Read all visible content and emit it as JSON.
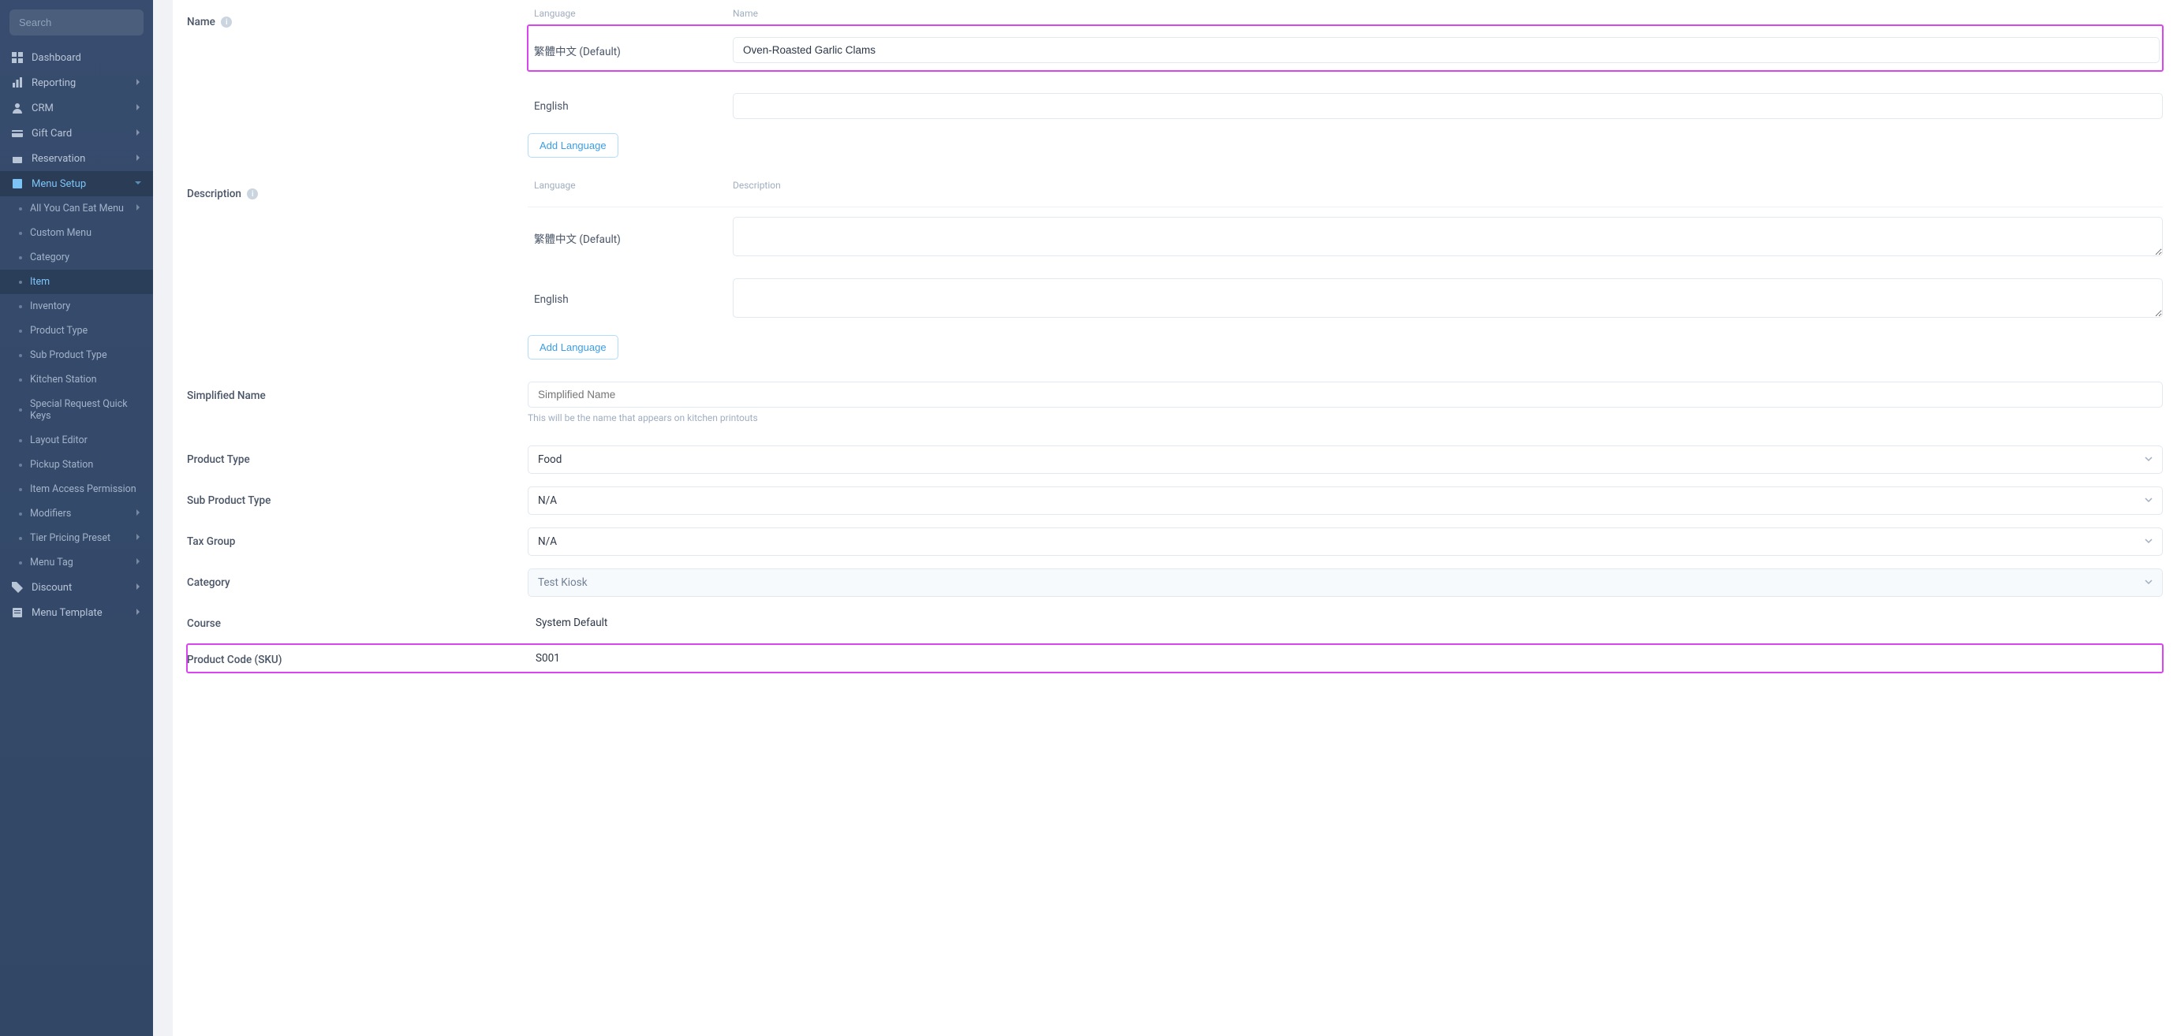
{
  "sidebar": {
    "search_placeholder": "Search",
    "items": [
      {
        "label": "Dashboard"
      },
      {
        "label": "Reporting",
        "expandable": true
      },
      {
        "label": "CRM",
        "expandable": true
      },
      {
        "label": "Gift Card",
        "expandable": true
      },
      {
        "label": "Reservation",
        "expandable": true
      },
      {
        "label": "Menu Setup",
        "expandable": true,
        "active": true
      },
      {
        "label": "Discount",
        "expandable": true
      },
      {
        "label": "Menu Template",
        "expandable": true
      }
    ],
    "menu_setup_sub": [
      {
        "label": "All You Can Eat Menu",
        "expandable": true
      },
      {
        "label": "Custom Menu"
      },
      {
        "label": "Category"
      },
      {
        "label": "Item",
        "active": true
      },
      {
        "label": "Inventory"
      },
      {
        "label": "Product Type"
      },
      {
        "label": "Sub Product Type"
      },
      {
        "label": "Kitchen Station"
      },
      {
        "label": "Special Request Quick Keys"
      },
      {
        "label": "Layout Editor"
      },
      {
        "label": "Pickup Station"
      },
      {
        "label": "Item Access Permission"
      },
      {
        "label": "Modifiers",
        "expandable": true
      },
      {
        "label": "Tier Pricing Preset",
        "expandable": true
      },
      {
        "label": "Menu Tag",
        "expandable": true
      }
    ]
  },
  "form": {
    "name_label": "Name",
    "description_label": "Description",
    "headers": {
      "language": "Language",
      "name": "Name",
      "description": "Description"
    },
    "name_rows": [
      {
        "lang": "繁體中文 (Default)",
        "value": "Oven-Roasted Garlic Clams"
      },
      {
        "lang": "English",
        "value": ""
      }
    ],
    "desc_rows": [
      {
        "lang": "繁體中文 (Default)",
        "value": ""
      },
      {
        "lang": "English",
        "value": ""
      }
    ],
    "add_language": "Add Language",
    "simplified_name": {
      "label": "Simplified Name",
      "placeholder": "Simplified Name",
      "helper": "This will be the name that appears on kitchen printouts"
    },
    "product_type": {
      "label": "Product Type",
      "value": "Food"
    },
    "sub_product_type": {
      "label": "Sub Product Type",
      "value": "N/A"
    },
    "tax_group": {
      "label": "Tax Group",
      "value": "N/A"
    },
    "category": {
      "label": "Category",
      "value": "Test Kiosk"
    },
    "course": {
      "label": "Course",
      "value": "System Default"
    },
    "sku": {
      "label": "Product Code (SKU)",
      "value": "S001"
    }
  }
}
